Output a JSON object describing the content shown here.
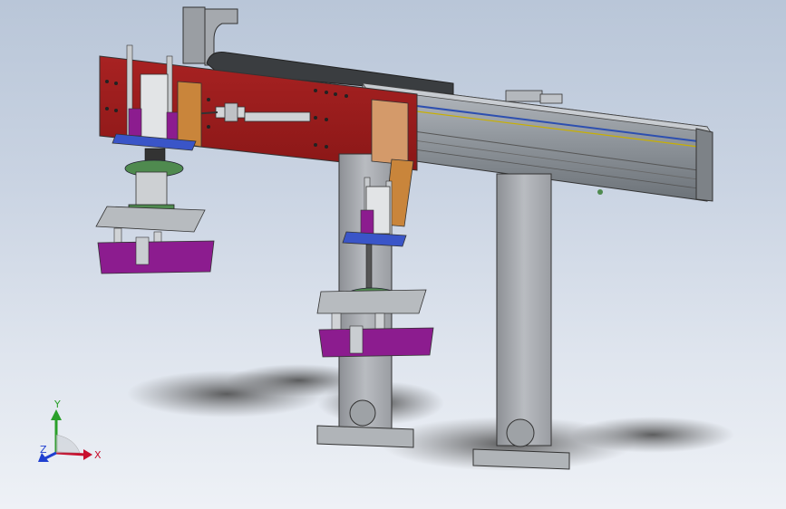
{
  "viewport": {
    "background_top": "#b9c6d8",
    "background_bottom": "#eef1f6"
  },
  "model": {
    "description_colors": {
      "frame_red": "#9b1c1c",
      "rail_gray": "#8c9196",
      "column_gray": "#a3a6ab",
      "pad_purple": "#8c1c8f",
      "mount_green": "#4f8a4f",
      "bracket_orange": "#c9853b",
      "plate_blue": "#3a55c8"
    }
  },
  "triad": {
    "x_label": "X",
    "y_label": "Y",
    "z_label": "Z",
    "x_color": "#c8102e",
    "y_color": "#2aa02a",
    "z_color": "#1f3fd0"
  }
}
